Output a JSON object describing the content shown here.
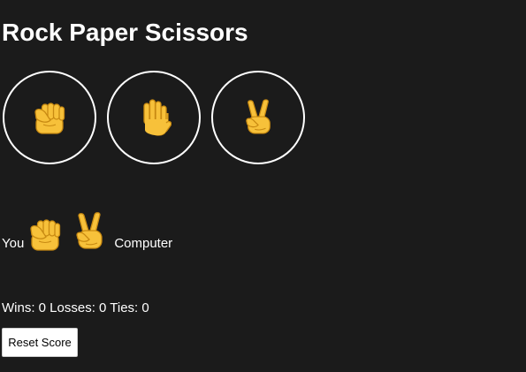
{
  "title": "Rock Paper Scissors",
  "choices": [
    {
      "name": "rock",
      "icon": "raised-fist-icon"
    },
    {
      "name": "paper",
      "icon": "raised-hand-icon"
    },
    {
      "name": "scissors",
      "icon": "victory-hand-icon"
    }
  ],
  "result": {
    "you_label": "You",
    "you_choice_icon": "raised-fist-icon",
    "computer_choice_icon": "victory-hand-icon",
    "computer_label": "Computer"
  },
  "score": {
    "text": "Wins: 0 Losses: 0 Ties: 0",
    "wins": 0,
    "losses": 0,
    "ties": 0
  },
  "reset_label": "Reset Score",
  "colors": {
    "background": "#1b1b1b",
    "text": "#ffffff",
    "hand_fill": "#f7c13a",
    "hand_stroke": "#c88a12"
  }
}
